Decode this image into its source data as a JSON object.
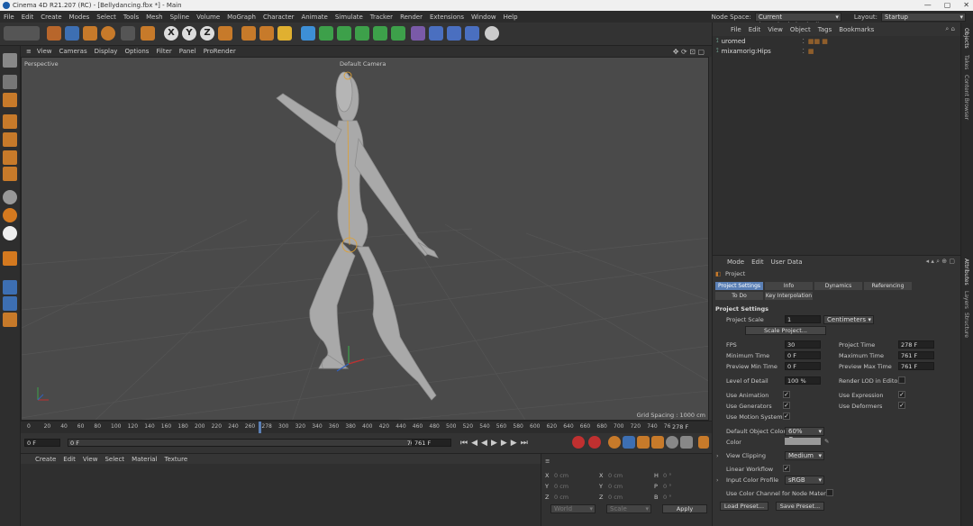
{
  "window": {
    "title": "Cinema 4D R21.207 (RC) - [Bellydancing.fbx *] - Main",
    "minimize": "—",
    "maximize": "▢",
    "close": "✕"
  },
  "menu": [
    "File",
    "Edit",
    "Create",
    "Modes",
    "Select",
    "Tools",
    "Mesh",
    "Spline",
    "Volume",
    "MoGraph",
    "Character",
    "Animate",
    "Simulate",
    "Tracker",
    "Render",
    "Extensions",
    "Window",
    "Help"
  ],
  "node_space": {
    "label": "Node Space:",
    "value": "Current (Standard/Physical)"
  },
  "layout": {
    "label": "Layout:",
    "value": "Startup"
  },
  "viewport_menu": [
    "View",
    "Cameras",
    "Display",
    "Options",
    "Filter",
    "Panel",
    "ProRender"
  ],
  "viewport": {
    "projection": "Perspective",
    "camera": "Default Camera",
    "grid_spacing": "Grid Spacing : 1000 cm"
  },
  "toolbar_axes": [
    "X",
    "Y",
    "Z"
  ],
  "ruler": {
    "ticks": [
      "0",
      "20",
      "40",
      "60",
      "80",
      "100",
      "120",
      "140",
      "160",
      "180",
      "200",
      "220",
      "240",
      "260",
      "278",
      "300",
      "320",
      "340",
      "360",
      "380",
      "400",
      "420",
      "440",
      "460",
      "480",
      "500",
      "520",
      "540",
      "560",
      "580",
      "600",
      "620",
      "640",
      "660",
      "680",
      "700",
      "720",
      "740",
      "76"
    ],
    "end": "278 F"
  },
  "transport": {
    "start": "0 F",
    "current": "0 F",
    "end": "761 F",
    "end2": "761 F"
  },
  "material_menu": [
    "Create",
    "Edit",
    "View",
    "Select",
    "Material",
    "Texture"
  ],
  "coords": {
    "rows": [
      [
        "X",
        "0 cm",
        "X",
        "0 cm",
        "H",
        "0 °"
      ],
      [
        "Y",
        "0 cm",
        "Y",
        "0 cm",
        "P",
        "0 °"
      ],
      [
        "Z",
        "0 cm",
        "Z",
        "0 cm",
        "B",
        "0 °"
      ]
    ],
    "mode1": "World",
    "mode2": "Scale",
    "apply": "Apply"
  },
  "object_menu": [
    "File",
    "Edit",
    "View",
    "Object",
    "Tags",
    "Bookmarks"
  ],
  "objects": [
    {
      "name": "uromed"
    },
    {
      "name": "mixamorig:Hips"
    }
  ],
  "attr_menu": [
    "Mode",
    "Edit",
    "User Data"
  ],
  "attr": {
    "title": "Project",
    "tabs": [
      "Project Settings",
      "Info",
      "Dynamics",
      "Referencing"
    ],
    "tabs2": [
      "To Do",
      "Key Interpolation"
    ],
    "section": "Project Settings",
    "project_scale_label": "Project Scale",
    "project_scale_value": "1",
    "project_scale_unit": "Centimeters",
    "scale_project_btn": "Scale Project...",
    "fps_label": "FPS",
    "fps_value": "30",
    "project_time_label": "Project Time",
    "project_time_value": "278 F",
    "min_time_label": "Minimum Time",
    "min_time_value": "0 F",
    "max_time_label": "Maximum Time",
    "max_time_value": "761 F",
    "prev_min_label": "Preview Min Time",
    "prev_min_value": "0 F",
    "prev_max_label": "Preview Max Time",
    "prev_max_value": "761 F",
    "lod_label": "Level of Detail",
    "lod_value": "100 %",
    "render_lod_label": "Render LOD in Editor",
    "use_animation_label": "Use Animation",
    "use_expression_label": "Use Expression",
    "use_generators_label": "Use Generators",
    "use_deformers_label": "Use Deformers",
    "use_motion_label": "Use Motion System",
    "default_color_label": "Default Object Color",
    "default_color_value": "60% Gray",
    "color_label": "Color",
    "view_clipping_label": "View Clipping",
    "view_clipping_value": "Medium",
    "linear_workflow_label": "Linear Workflow",
    "input_profile_label": "Input Color Profile",
    "input_profile_value": "sRGB",
    "use_color_channel_label": "Use Color Channel for Node Material",
    "load_preset": "Load Preset...",
    "save_preset": "Save Preset...",
    "check": "✓"
  },
  "side_tabs": [
    "Objects",
    "Takes",
    "Content Browser",
    "Attributes",
    "Layers",
    "Structure"
  ]
}
